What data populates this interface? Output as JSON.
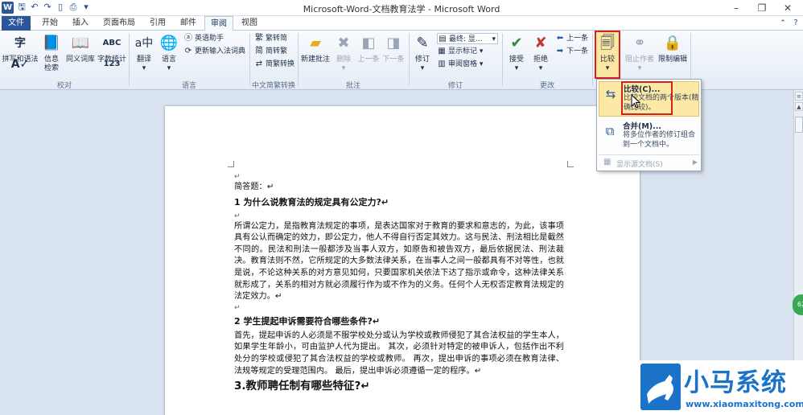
{
  "titlebar": {
    "app_logo": "W",
    "title": "Microsoft-Word-文档教育法学 - Microsoft Word",
    "quick_access": [
      "save-icon",
      "undo-icon",
      "redo-icon",
      "new-doc-icon",
      "print-preview-icon"
    ],
    "window_buttons": [
      "–",
      "❐",
      "✕"
    ]
  },
  "tabs": [
    {
      "label": "文件"
    },
    {
      "label": "开始"
    },
    {
      "label": "插入"
    },
    {
      "label": "页面布局"
    },
    {
      "label": "引用"
    },
    {
      "label": "邮件"
    },
    {
      "label": "审阅"
    },
    {
      "label": "视图"
    }
  ],
  "ribbon": {
    "proofing": {
      "label": "校对",
      "spelling": "拼写和语法",
      "research": "信息检索",
      "thesaurus": "同义词库",
      "word_count": "字数统计"
    },
    "language": {
      "label": "语言",
      "translate": "翻译",
      "language": "语言",
      "english_assistant": "英语助手",
      "update_ime": "更新输入法词典"
    },
    "chinese_conversion": {
      "label": "中文简繁转换",
      "to_simplified": "繁转简",
      "to_traditional": "简转繁",
      "conversion": "简繁转换"
    },
    "comments": {
      "label": "批注",
      "new": "新建批注",
      "delete": "删除",
      "previous": "上一条",
      "next": "下一条"
    },
    "tracking": {
      "label": "修订",
      "track_changes": "修订",
      "display_mode": "最终: 显...",
      "show_markup": "显示标记",
      "reviewing_pane": "审阅窗格"
    },
    "changes": {
      "label": "更改",
      "accept": "接受",
      "reject": "拒绝",
      "previous": "上一条",
      "next": "下一条"
    },
    "compare": {
      "compare": "比较",
      "block_authors": "阻止作者",
      "restrict_editing": "限制编辑"
    }
  },
  "dropdown": {
    "compare": {
      "title": "比较(C)...",
      "desc": "比较文档的两个版本(精确比较)。"
    },
    "combine": {
      "title": "合并(M)...",
      "desc": "将多位作者的修订组合到一个文档中。"
    },
    "show_source": "显示源文档(S)"
  },
  "document": {
    "pmark": "↵",
    "intro": "简答题：↵",
    "q1": "1 为什么说教育法的规定具有公定力?↵",
    "p1": "所谓公定力，是指教育法规定的事项，是表达国家对于教育的要求和意志的，为此，该事项具有公认而确定的效力，即公定力，他人不得自行否定其效力。这与民法、刑法相比是截然不同的。民法和刑法一般都涉及当事人双方，如原告和被告双方，最后依据民法、刑法裁决。教育法则不然，它所规定的大多数法律关系，在当事人之间一般都具有不对等性，也就是说，不论这种关系的对方意见如何，只要国家机关依法下达了指示或命令，这种法律关系就形成了，关系的相对方就必须履行作为或不作为的义务。任何个人无权否定教育法规定的法定效力。↵",
    "q2": "2 学生提起申诉需要符合哪些条件?↵",
    "p2": "首先，提起申诉的人必须是不服学校处分或认为学校或教师侵犯了其合法权益的学生本人，如果学生年龄小，可由监护人代为提出。 其次，必须针对特定的被申诉人，包括作出不利处分的学校或侵犯了其合法权益的学校或教师。 再次，提出申诉的事项必须在教育法律、法规等规定的受理范围内。 最后，提出申诉必须遵循一定的程序。↵",
    "q3": "3.教师聘任制有哪些特征?↵"
  },
  "watermark": {
    "name": "小马系统",
    "url": "www.xiaomaxitong.com"
  },
  "colors": {
    "accent": "#2b579a",
    "highlight_border": "#d5221d",
    "watermark": "#1a73c9",
    "dropdown_hover": "#fce9a6"
  }
}
